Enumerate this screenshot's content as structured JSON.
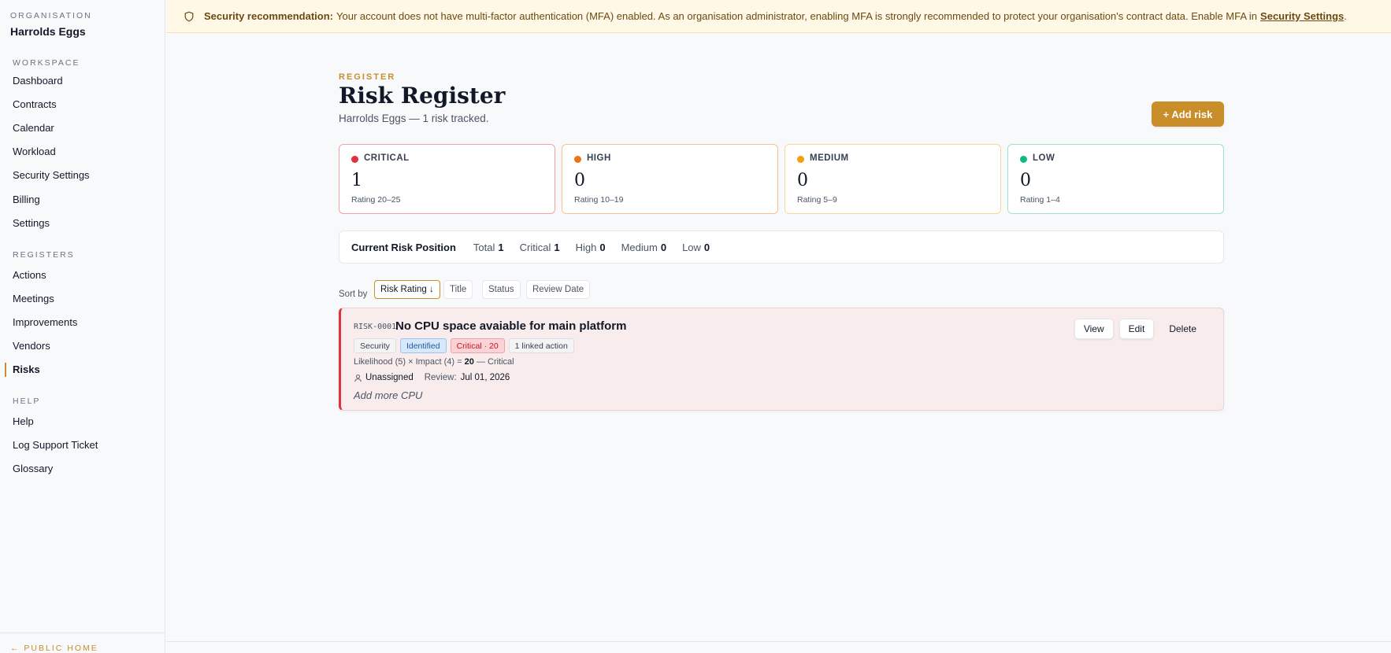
{
  "sidebar": {
    "org_label": "ORGANISATION",
    "org_name": "Harrolds Eggs",
    "sections": [
      {
        "label": "WORKSPACE",
        "items": [
          "Dashboard",
          "Contracts",
          "Calendar",
          "Workload",
          "Security Settings",
          "Billing",
          "Settings"
        ]
      },
      {
        "label": "REGISTERS",
        "items": [
          "Actions",
          "Meetings",
          "Improvements",
          "Vendors",
          "Risks"
        ]
      },
      {
        "label": "HELP",
        "items": [
          "Help",
          "Log Support Ticket",
          "Glossary"
        ]
      }
    ],
    "active_item": "Risks",
    "footer_link": "← PUBLIC HOME"
  },
  "banner": {
    "icon": "shield-icon",
    "heading": "Security recommendation:",
    "message": "Your account does not have multi-factor authentication (MFA) enabled. As an organisation administrator, enabling MFA is strongly recommended to protect your organisation's contract data. Enable MFA in",
    "link_text": "Security Settings",
    "trailing": "."
  },
  "header": {
    "eyebrow": "REGISTER",
    "title": "Risk Register",
    "subtitle": "Harrolds Eggs — 1 risk tracked.",
    "add_button": "+ Add risk"
  },
  "stats": [
    {
      "label": "CRITICAL",
      "value": "1",
      "range": "Rating 20–25",
      "color": "#e0313d",
      "border": "#f3a1a7"
    },
    {
      "label": "HIGH",
      "value": "0",
      "range": "Rating 10–19",
      "color": "#f07313",
      "border": "#f8c08e"
    },
    {
      "label": "MEDIUM",
      "value": "0",
      "range": "Rating 5–9",
      "color": "#f59e0b",
      "border": "#f9d796"
    },
    {
      "label": "LOW",
      "value": "0",
      "range": "Rating 1–4",
      "color": "#10b981",
      "border": "#9fe1cb"
    }
  ],
  "position": {
    "title": "Current Risk Position",
    "metrics": [
      {
        "label": "Total",
        "value": "1"
      },
      {
        "label": "Critical",
        "value": "1"
      },
      {
        "label": "High",
        "value": "0"
      },
      {
        "label": "Medium",
        "value": "0"
      },
      {
        "label": "Low",
        "value": "0"
      }
    ]
  },
  "sort": {
    "label": "Sort by",
    "options": [
      "Risk Rating ↓",
      "Title",
      "Status",
      "Review Date"
    ],
    "active": "Risk Rating ↓"
  },
  "risks": [
    {
      "id": "RISK-0001",
      "title": "No CPU space avaiable for main platform",
      "chips": [
        "Security",
        "Identified",
        "Critical · 20",
        "1 linked action"
      ],
      "formula_prefix": "Likelihood (5) × Impact (4) =",
      "score": "20",
      "formula_suffix": "— Critical",
      "owner": "Unassigned",
      "review_label": "Review:",
      "review_date": "Jul 01, 2026",
      "note": "Add more CPU",
      "actions": [
        "View",
        "Edit",
        "Delete"
      ]
    }
  ]
}
